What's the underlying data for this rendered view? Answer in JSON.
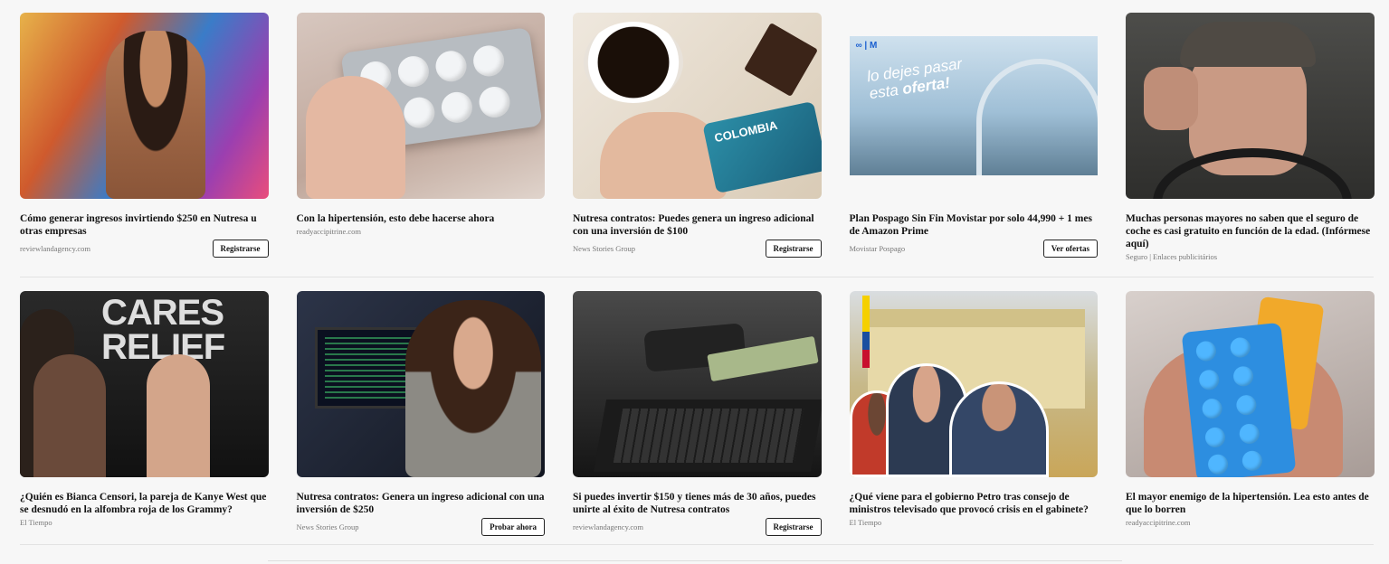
{
  "colors": {
    "background": "#f7f7f7",
    "title": "#111111",
    "source": "#777777",
    "cta_border": "#222222"
  },
  "row1": [
    {
      "title": "Cómo generar ingresos invirtiendo $250 en Nutresa u otras empresas",
      "source": "reviewlandagency.com",
      "cta": "Registrarse",
      "image": "woman-with-money-photo"
    },
    {
      "title": "Con la hipertensión, esto debe hacerse ahora",
      "source": "readyaccipitrine.com",
      "cta": "",
      "image": "pill-blister-photo"
    },
    {
      "title": "Nutresa contratos: Puedes genera un ingreso adicional con una inversión de $100",
      "source": "News Stories Group",
      "cta": "Registrarse",
      "image": "coffee-and-card-photo",
      "image_card_text": "COLOMBIA"
    },
    {
      "title": "Plan Pospago Sin Fin Movistar por solo 44,990 + 1 mes de Amazon Prime",
      "source": "Movistar Pospago",
      "cta": "Ver ofertas",
      "image": "movistar-ad-banner",
      "image_text_1": "lo dejes pasar",
      "image_text_2": "esta ",
      "image_text_3": "oferta!"
    },
    {
      "title": "Muchas personas mayores no saben que el seguro de coche es casi gratuito en función de la edad. (Infórmese aquí)",
      "source": "Seguro | Enlaces publicitários",
      "cta": "",
      "image": "elderly-driver-photo"
    }
  ],
  "row2": [
    {
      "title": "¿Quién es Bianca Censori, la pareja de Kanye West que se desnudó en la alfombra roja de los Grammy?",
      "source": "El Tiempo",
      "cta": "",
      "image": "red-carpet-photo",
      "image_sign": "CARES RELIEF"
    },
    {
      "title": "Nutresa contratos: Genera un ingreso adicional con una inversión de $250",
      "source": "News Stories Group",
      "cta": "Probar ahora",
      "image": "woman-at-computer-photo"
    },
    {
      "title": "Si puedes invertir $150 y tienes más de 30 años, puedes unirte al éxito de Nutresa contratos",
      "source": "reviewlandagency.com",
      "cta": "Registrarse",
      "image": "laptop-money-photo"
    },
    {
      "title": "¿Qué viene para el gobierno Petro tras consejo de ministros televisado que provocó crisis en el gabinete?",
      "source": "El Tiempo",
      "cta": "",
      "image": "politicians-collage-photo"
    },
    {
      "title": "El mayor enemigo de la hipertensión. Lea esto antes de que lo borren",
      "source": "readyaccipitrine.com",
      "cta": "",
      "image": "blue-pills-photo"
    }
  ]
}
